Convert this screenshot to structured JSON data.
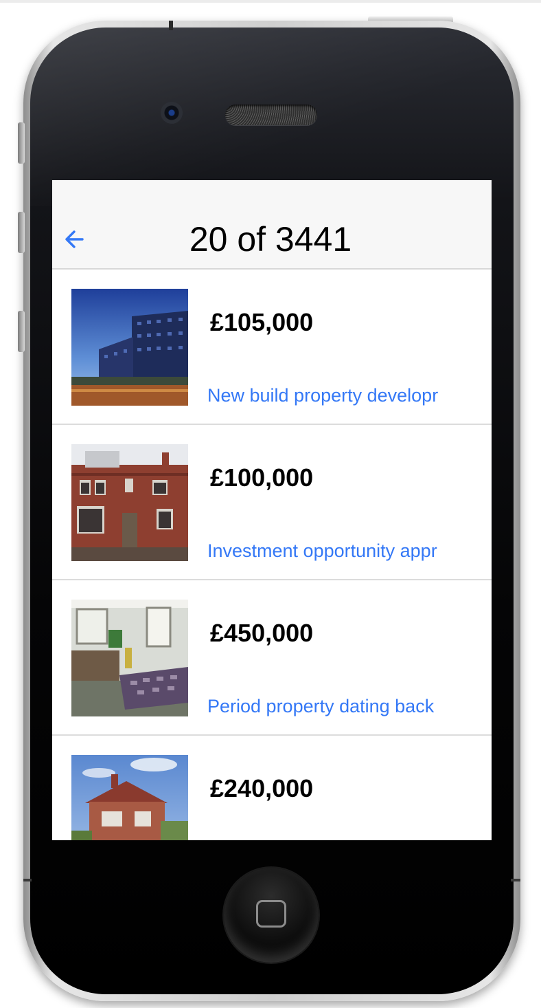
{
  "nav": {
    "title": "20 of 3441",
    "back_icon": "arrow-left-icon"
  },
  "listings": [
    {
      "price": "£105,000",
      "description": "New build property developr",
      "photo": "modern-apartment-block"
    },
    {
      "price": "£100,000",
      "description": "Investment opportunity appr",
      "photo": "red-brick-terrace"
    },
    {
      "price": "£450,000",
      "description": "Period property dating back",
      "photo": "bedroom-interior"
    },
    {
      "price": "£240,000",
      "description": "",
      "photo": "brick-semi-detached"
    }
  ],
  "colors": {
    "accent": "#3478f6",
    "navbar_bg": "#f7f7f7",
    "divider": "#dcdcdc"
  }
}
